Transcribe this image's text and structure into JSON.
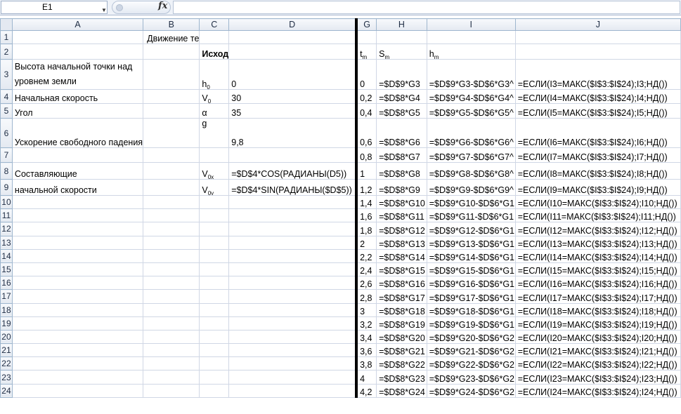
{
  "formula_bar": {
    "name_box": "E1",
    "fx": "fx",
    "formula": ""
  },
  "columns": [
    "A",
    "B",
    "C",
    "D",
    "G",
    "H",
    "I",
    "J"
  ],
  "rows": [
    {
      "n": "1",
      "A": "",
      "B": "Движение те",
      "C": "",
      "D": "",
      "G": "",
      "H": "",
      "I": "",
      "J": ""
    },
    {
      "n": "2",
      "A": "",
      "B": "",
      "C": "Исход",
      "D": "",
      "G": "t",
      "G_sub": "m",
      "H": "S",
      "H_sub": "m",
      "I": "h",
      "I_sub": "m",
      "J": ""
    },
    {
      "n": "3",
      "A": "Высота начальной точки над уровнем земли",
      "B": "",
      "C": "h",
      "C_sub": "0",
      "D": "0",
      "G": "0",
      "H": "=$D$9*G3",
      "I": "=$D$9*G3-$D$6*G3^",
      "J": "=ЕСЛИ(I3=МАКС($I$3:$I$24);I3;НД())"
    },
    {
      "n": "4",
      "A": "Начальная скорость",
      "B": "",
      "C": "V",
      "C_sub": "0",
      "D": "30",
      "G": "0,2",
      "H": "=$D$8*G4",
      "I": "=$D$9*G4-$D$6*G4^",
      "J": "=ЕСЛИ(I4=МАКС($I$3:$I$24);I4;НД())"
    },
    {
      "n": "5",
      "A": "Угол",
      "B": "",
      "C": "α",
      "D": "35",
      "G": "0,4",
      "H": "=$D$8*G5",
      "I": "=$D$9*G5-$D$6*G5^",
      "J": "=ЕСЛИ(I5=МАКС($I$3:$I$24);I5;НД())"
    },
    {
      "n": "6",
      "A": "Ускорение свободного падения",
      "B": "",
      "C": "g",
      "D": "9,8",
      "G": "0,6",
      "H": "=$D$8*G6",
      "I": "=$D$9*G6-$D$6*G6^",
      "J": "=ЕСЛИ(I6=МАКС($I$3:$I$24);I6;НД())"
    },
    {
      "n": "7",
      "A": "",
      "B": "",
      "C": "",
      "D": "",
      "G": "0,8",
      "H": "=$D$8*G7",
      "I": "=$D$9*G7-$D$6*G7^",
      "J": "=ЕСЛИ(I7=МАКС($I$3:$I$24);I7;НД())"
    },
    {
      "n": "8",
      "A": "Составляющие",
      "B": "",
      "C": "V",
      "C_sub": "0x",
      "D": "=$D$4*COS(РАДИАНЫ(D5))",
      "G": "1",
      "H": "=$D$8*G8",
      "I": "=$D$9*G8-$D$6*G8^",
      "J": "=ЕСЛИ(I8=МАКС($I$3:$I$24);I8;НД())"
    },
    {
      "n": "9",
      "A": "начальной скорости",
      "B": "",
      "C": "V",
      "C_sub": "0y",
      "D": "=$D$4*SIN(РАДИАНЫ($D$5))",
      "G": "1,2",
      "H": "=$D$8*G9",
      "I": "=$D$9*G9-$D$6*G9^",
      "J": "=ЕСЛИ(I9=МАКС($I$3:$I$24);I9;НД())"
    },
    {
      "n": "10",
      "A": "",
      "B": "",
      "C": "",
      "D": "",
      "G": "1,4",
      "H": "=$D$8*G10",
      "I": "=$D$9*G10-$D$6*G1",
      "J": "=ЕСЛИ(I10=МАКС($I$3:$I$24);I10;НД())"
    },
    {
      "n": "11",
      "A": "",
      "B": "",
      "C": "",
      "D": "",
      "G": "1,6",
      "H": "=$D$8*G11",
      "I": "=$D$9*G11-$D$6*G1",
      "J": "=ЕСЛИ(I11=МАКС($I$3:$I$24);I11;НД())"
    },
    {
      "n": "12",
      "A": "",
      "B": "",
      "C": "",
      "D": "",
      "G": "1,8",
      "H": "=$D$8*G12",
      "I": "=$D$9*G12-$D$6*G1",
      "J": "=ЕСЛИ(I12=МАКС($I$3:$I$24);I12;НД())"
    },
    {
      "n": "13",
      "A": "",
      "B": "",
      "C": "",
      "D": "",
      "G": "2",
      "H": "=$D$8*G13",
      "I": "=$D$9*G13-$D$6*G1",
      "J": "=ЕСЛИ(I13=МАКС($I$3:$I$24);I13;НД())"
    },
    {
      "n": "14",
      "A": "",
      "B": "",
      "C": "",
      "D": "",
      "G": "2,2",
      "H": "=$D$8*G14",
      "I": "=$D$9*G14-$D$6*G1",
      "J": "=ЕСЛИ(I14=МАКС($I$3:$I$24);I14;НД())"
    },
    {
      "n": "15",
      "A": "",
      "B": "",
      "C": "",
      "D": "",
      "G": "2,4",
      "H": "=$D$8*G15",
      "I": "=$D$9*G15-$D$6*G1",
      "J": "=ЕСЛИ(I15=МАКС($I$3:$I$24);I15;НД())"
    },
    {
      "n": "16",
      "A": "",
      "B": "",
      "C": "",
      "D": "",
      "G": "2,6",
      "H": "=$D$8*G16",
      "I": "=$D$9*G16-$D$6*G1",
      "J": "=ЕСЛИ(I16=МАКС($I$3:$I$24);I16;НД())"
    },
    {
      "n": "17",
      "A": "",
      "B": "",
      "C": "",
      "D": "",
      "G": "2,8",
      "H": "=$D$8*G17",
      "I": "=$D$9*G17-$D$6*G1",
      "J": "=ЕСЛИ(I17=МАКС($I$3:$I$24);I17;НД())"
    },
    {
      "n": "18",
      "A": "",
      "B": "",
      "C": "",
      "D": "",
      "G": "3",
      "H": "=$D$8*G18",
      "I": "=$D$9*G18-$D$6*G1",
      "J": "=ЕСЛИ(I18=МАКС($I$3:$I$24);I18;НД())"
    },
    {
      "n": "19",
      "A": "",
      "B": "",
      "C": "",
      "D": "",
      "G": "3,2",
      "H": "=$D$8*G19",
      "I": "=$D$9*G19-$D$6*G1",
      "J": "=ЕСЛИ(I19=МАКС($I$3:$I$24);I19;НД())"
    },
    {
      "n": "20",
      "A": "",
      "B": "",
      "C": "",
      "D": "",
      "G": "3,4",
      "H": "=$D$8*G20",
      "I": "=$D$9*G20-$D$6*G2",
      "J": "=ЕСЛИ(I20=МАКС($I$3:$I$24);I20;НД())"
    },
    {
      "n": "21",
      "A": "",
      "B": "",
      "C": "",
      "D": "",
      "G": "3,6",
      "H": "=$D$8*G21",
      "I": "=$D$9*G21-$D$6*G2",
      "J": "=ЕСЛИ(I21=МАКС($I$3:$I$24);I21;НД())"
    },
    {
      "n": "22",
      "A": "",
      "B": "",
      "C": "",
      "D": "",
      "G": "3,8",
      "H": "=$D$8*G22",
      "I": "=$D$9*G22-$D$6*G2",
      "J": "=ЕСЛИ(I22=МАКС($I$3:$I$24);I22;НД())"
    },
    {
      "n": "23",
      "A": "",
      "B": "",
      "C": "",
      "D": "",
      "G": "4",
      "H": "=$D$8*G23",
      "I": "=$D$9*G23-$D$6*G2",
      "J": "=ЕСЛИ(I23=МАКС($I$3:$I$24);I23;НД())"
    },
    {
      "n": "24",
      "A": "",
      "B": "",
      "C": "",
      "D": "",
      "G": "4,2",
      "H": "=$D$8*G24",
      "I": "=$D$9*G24-$D$6*G2",
      "J": "=ЕСЛИ(I24=МАКС($I$3:$I$24);I24;НД())"
    }
  ]
}
